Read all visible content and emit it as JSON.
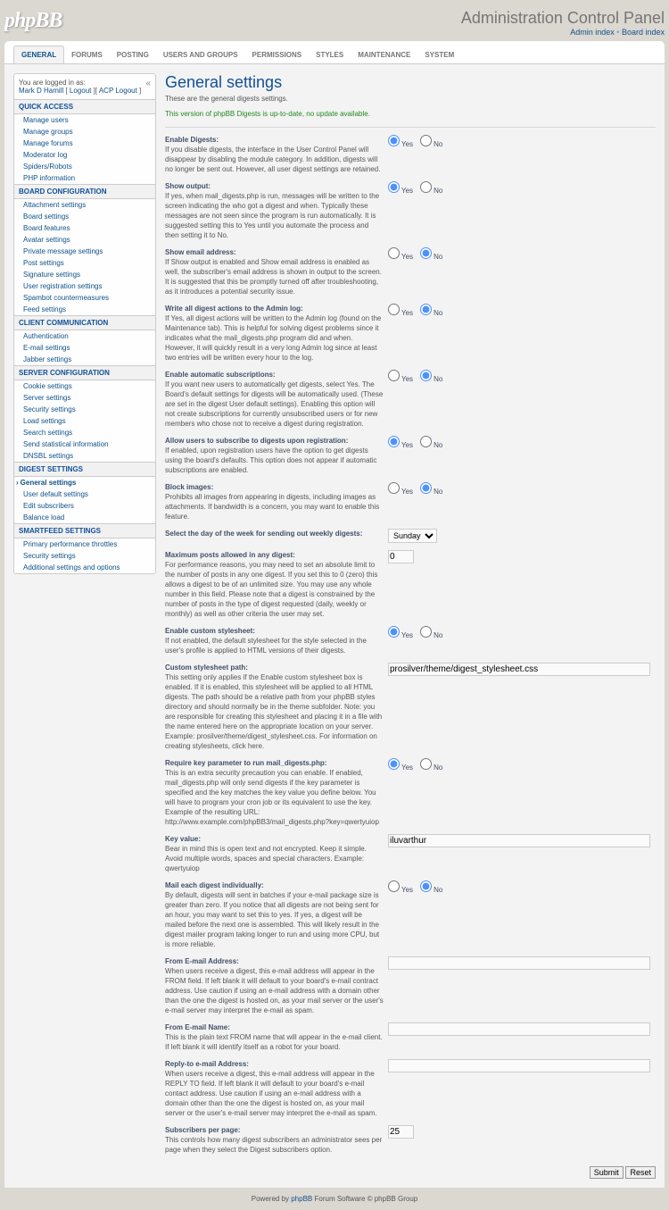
{
  "header": {
    "title": "Administration Control Panel",
    "link1": "Admin index",
    "link2": "Board index"
  },
  "tabs": [
    "GENERAL",
    "FORUMS",
    "POSTING",
    "USERS AND GROUPS",
    "PERMISSIONS",
    "STYLES",
    "MAINTENANCE",
    "SYSTEM"
  ],
  "login": {
    "l1": "You are logged in as:",
    "user": "Mark D Hamill",
    "sep1": " [ ",
    "logout": "Logout",
    "sep2": " ][ ",
    "acp": "ACP Logout",
    "sep3": " ]"
  },
  "side": [
    {
      "cat": "QUICK ACCESS",
      "items": [
        "Manage users",
        "Manage groups",
        "Manage forums",
        "Moderator log",
        "Spiders/Robots",
        "PHP information"
      ]
    },
    {
      "cat": "BOARD CONFIGURATION",
      "items": [
        "Attachment settings",
        "Board settings",
        "Board features",
        "Avatar settings",
        "Private message settings",
        "Post settings",
        "Signature settings",
        "User registration settings",
        "Spambot countermeasures",
        "Feed settings"
      ]
    },
    {
      "cat": "CLIENT COMMUNICATION",
      "items": [
        "Authentication",
        "E-mail settings",
        "Jabber settings"
      ]
    },
    {
      "cat": "SERVER CONFIGURATION",
      "items": [
        "Cookie settings",
        "Server settings",
        "Security settings",
        "Load settings",
        "Search settings",
        "Send statistical information",
        "DNSBL settings"
      ]
    },
    {
      "cat": "DIGEST SETTINGS",
      "sel": 0,
      "items": [
        "General settings",
        "User default settings",
        "Edit subscribers",
        "Balance load"
      ]
    },
    {
      "cat": "SMARTFEED SETTINGS",
      "items": [
        "Primary performance throttles",
        "Security settings",
        "Additional settings and options"
      ]
    }
  ],
  "page": {
    "title": "General settings",
    "sub": "These are the general digests settings.",
    "update": "This version of phpBB Digests is up-to-date, no update available."
  },
  "opts": [
    {
      "l": "Enable Digests:",
      "d": "If you disable digests, the interface in the User Control Panel will disappear by disabling the module category. In addition, digests will no longer be sent out. However, all user digest settings are retained.",
      "t": "radio",
      "v": "yes"
    },
    {
      "l": "Show output:",
      "d": "If yes, when mail_digests.php is run, messages will be written to the screen indicating the who got a digest and when. Typically these messages are not seen since the program is run automatically. It is suggested setting this to Yes until you automate the process and then setting it to No.",
      "t": "radio",
      "v": "yes"
    },
    {
      "l": "Show email address:",
      "d": "If Show output is enabled and Show email address is enabled as well, the subscriber's email address is shown in output to the screen. It is suggested that this be promptly turned off after troubleshooting, as it introduces a potential security issue.",
      "t": "radio",
      "v": "no"
    },
    {
      "l": "Write all digest actions to the Admin log:",
      "d": "If Yes, all digest actions will be written to the Admin log (found on the Maintenance tab). This is helpful for solving digest problems since it indicates what the mail_digests.php program did and when. However, it will quickly result in a very long Admin log since at least two entries will be written every hour to the log.",
      "t": "radio",
      "v": "no"
    },
    {
      "l": "Enable automatic subscriptions:",
      "d": "If you want new users to automatically get digests, select Yes. The Board's default settings for digests will be automatically used. (These are set in the digest User default settings). Enabling this option will not create subscriptions for currently unsubscribed users or for new members who chose not to receive a digest during registration.",
      "t": "radio",
      "v": "no"
    },
    {
      "l": "Allow users to subscribe to digests upon registration:",
      "d": "If enabled, upon registration users have the option to get digests using the board's defaults. This option does not appear if automatic subscriptions are enabled.",
      "t": "radio",
      "v": "yes"
    },
    {
      "l": "Block images:",
      "d": "Prohibits all images from appearing in digests, including images as attachments. If bandwidth is a concern, you may want to enable this feature.",
      "t": "radio",
      "v": "no"
    },
    {
      "l": "Select the day of the week for sending out weekly digests:",
      "t": "select",
      "v": "Sunday"
    },
    {
      "l": "Maximum posts allowed in any digest:",
      "d": "For performance reasons, you may need to set an absolute limit to the number of posts in any one digest. If you set this to 0 (zero) this allows a digest to be of an unlimited size. You may use any whole number in this field. Please note that a digest is constrained by the number of posts in the type of digest requested (daily, weekly or monthly) as well as other criteria the user may set.",
      "t": "text",
      "v": "0",
      "c": "small"
    },
    {
      "l": "Enable custom stylesheet:",
      "d": "If not enabled, the default stylesheet for the style selected in the user's profile is applied to HTML versions of their digests.",
      "t": "radio",
      "v": "yes"
    },
    {
      "l": "Custom stylesheet path:",
      "d": "This setting only applies if the Enable custom stylesheet box is enabled. If it is enabled, this stylesheet will be applied to all HTML digests. The path should be a relative path from your phpBB styles directory and should normally be in the theme subfolder. Note: you are responsible for creating this stylesheet and placing it in a file with the name entered here on the appropriate location on your server. Example: prosilver/theme/digest_stylesheet.css. For information on creating stylesheets, click here.",
      "t": "text",
      "v": "prosilver/theme/digest_stylesheet.css",
      "c": "wide"
    },
    {
      "l": "Require key parameter to run mail_digests.php:",
      "d": "This is an extra security precaution you can enable. If enabled, mail_digests.php will only send digests if the key parameter is specified and the key matches the key value you define below. You will have to program your cron job or its equivalent to use the key. Example of the resulting URL: http://www.example.com/phpBB3/mail_digests.php?key=qwertyuiop",
      "t": "radio",
      "v": "yes"
    },
    {
      "l": "Key value:",
      "d": "Bear in mind this is open text and not encrypted. Keep it simple. Avoid multiple words, spaces and special characters. Example: qwertyuiop",
      "t": "text",
      "v": "iluvarthur",
      "c": "wide"
    },
    {
      "l": "Mail each digest individually:",
      "d": "By default, digests will sent in batches if your e-mail package size is greater than zero. If you notice that all digests are not being sent for an hour, you may want to set this to yes. If yes, a digest will be mailed before the next one is assembled. This will likely result in the digest mailer program taking longer to run and using more CPU, but is more reliable.",
      "t": "radio",
      "v": "no"
    },
    {
      "l": "From E-mail Address:",
      "d": "When users receive a digest, this e-mail address will appear in the FROM field. If left blank it will default to your board's e-mail contract address. Use caution if using an e-mail address with a domain other than the one the digest is hosted on, as your mail server or the user's e-mail server may interpret the e-mail as spam.",
      "t": "text",
      "v": "",
      "c": "wide"
    },
    {
      "l": "From E-mail Name:",
      "d": "This is the plain text FROM name that will appear in the e-mail client. If left blank it will identify itself as a robot for your board.",
      "t": "text",
      "v": "",
      "c": "wide"
    },
    {
      "l": "Reply-to e-mail Address:",
      "d": "When users receive a digest, this e-mail address will appear in the REPLY TO field. If left blank it will default to your board's e-mail contact address. Use caution if using an e-mail address with a domain other than the one the digest is hosted on, as your mail server or the user's e-mail server may interpret the e-mail as spam.",
      "t": "text",
      "v": "",
      "c": "wide"
    },
    {
      "l": "Subscribers per page:",
      "d": "This controls how many digest subscribers an administrator sees per page when they select the Digest subscribers option.",
      "t": "text",
      "v": "25",
      "c": "small"
    }
  ],
  "btns": {
    "submit": "Submit",
    "reset": "Reset"
  },
  "txt": {
    "yes": "Yes",
    "no": "No"
  },
  "footer": {
    "p1": "Powered by ",
    "p2": "phpBB",
    "p3": " Forum Software © phpBB Group"
  }
}
